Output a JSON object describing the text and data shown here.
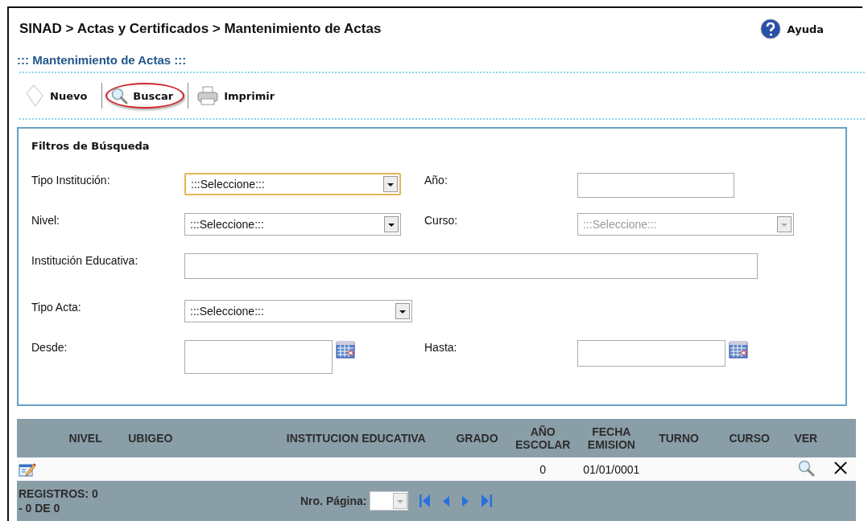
{
  "breadcrumb": "SINAD > Actas y Certificados > Mantenimiento de Actas",
  "help_link": "Ayuda",
  "page_title": "::: Mantenimiento de Actas :::",
  "toolbar": [
    {
      "label": "Nuevo",
      "kind": "new",
      "highlighted": false
    },
    {
      "label": "Buscar",
      "kind": "search",
      "highlighted": true
    },
    {
      "label": "Imprimir",
      "kind": "print",
      "highlighted": false
    }
  ],
  "filters": {
    "title": "Filtros de Búsqueda",
    "rows": [
      [
        {
          "label": "Tipo Institución:",
          "kind": "select",
          "value": ":::Seleccione:::",
          "focused": true,
          "disabled": false
        },
        {
          "label": "Año:",
          "kind": "text"
        }
      ],
      [
        {
          "label": "Nivel:",
          "kind": "select",
          "value": ":::Seleccione:::",
          "focused": false,
          "disabled": false
        },
        {
          "label": "Curso:",
          "kind": "select",
          "value": ":::Seleccione:::",
          "focused": false,
          "disabled": true
        }
      ],
      [
        {
          "label": "Institución Educativa:",
          "kind": "text"
        }
      ],
      [
        {
          "label": "Tipo Acta:",
          "kind": "select",
          "value": ":::Seleccione:::",
          "focused": false,
          "disabled": false
        }
      ],
      [
        {
          "label": "Desde:",
          "kind": "date"
        },
        {
          "label": "Hasta:",
          "kind": "date"
        }
      ]
    ]
  },
  "table": {
    "columns": [
      "NIVEL",
      "UBIGEO",
      "INSTITUCION EDUCATIVA",
      "GRADO",
      "AÑO ESCOLAR",
      "FECHA EMISION",
      "TURNO",
      "CURSO",
      "VER"
    ],
    "rows": [
      {
        "cells": [
          "",
          "",
          "",
          "",
          "0",
          "01/01/0001",
          "",
          "",
          ""
        ]
      }
    ]
  },
  "pager": {
    "records": "REGISTROS: 0",
    "range": "- 0 DE 0",
    "page_label": "Nro. Página:"
  }
}
